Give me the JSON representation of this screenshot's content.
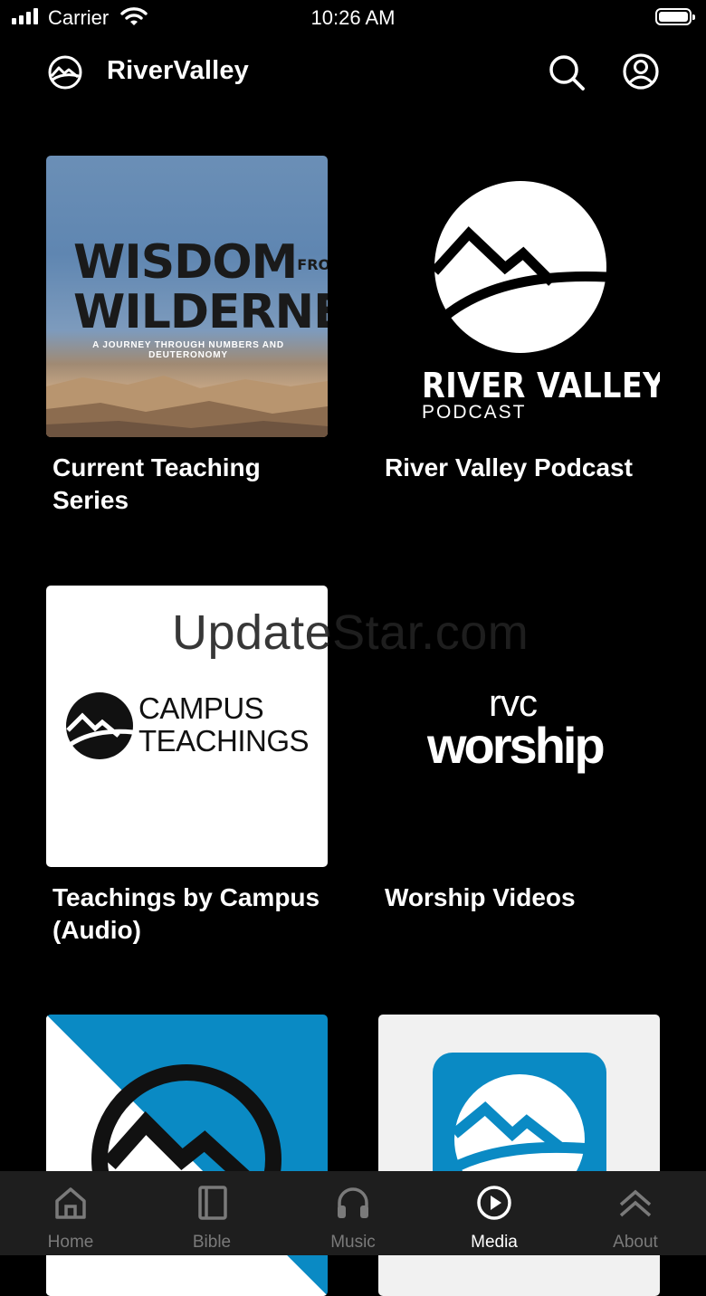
{
  "status_bar": {
    "carrier": "Carrier",
    "time": "10:26 AM"
  },
  "header": {
    "title": "RiverValley"
  },
  "tiles": [
    {
      "caption": "Current Teaching Series",
      "thumb": {
        "title_line1": "WISDOM",
        "title_small": "FROM THE",
        "title_line2": "WILDERNESS",
        "subtitle": "A JOURNEY THROUGH NUMBERS AND DEUTERONOMY"
      }
    },
    {
      "caption": "River Valley Podcast",
      "thumb": {
        "name": "RIVER VALLEY",
        "sub": "PODCAST"
      }
    },
    {
      "caption": "Teachings by Campus (Audio)",
      "thumb": {
        "line1": "CAMPUS",
        "line2": "TEACHINGS"
      }
    },
    {
      "caption": "Worship Videos",
      "thumb": {
        "line1": "rvc",
        "line2": "worship"
      }
    },
    {
      "caption": ""
    },
    {
      "caption": ""
    }
  ],
  "watermark": "UpdateStar.com",
  "tabbar": {
    "items": [
      {
        "label": "Home",
        "icon": "home-icon"
      },
      {
        "label": "Bible",
        "icon": "book-icon"
      },
      {
        "label": "Music",
        "icon": "headphones-icon"
      },
      {
        "label": "Media",
        "icon": "play-circle-icon",
        "active": true
      },
      {
        "label": "About",
        "icon": "double-chevron-up-icon"
      }
    ]
  },
  "colors": {
    "background": "#000000",
    "tabbar": "#1e1e1e",
    "brand_blue": "#0a8ac4",
    "inactive_tab": "#7a7a7a"
  }
}
